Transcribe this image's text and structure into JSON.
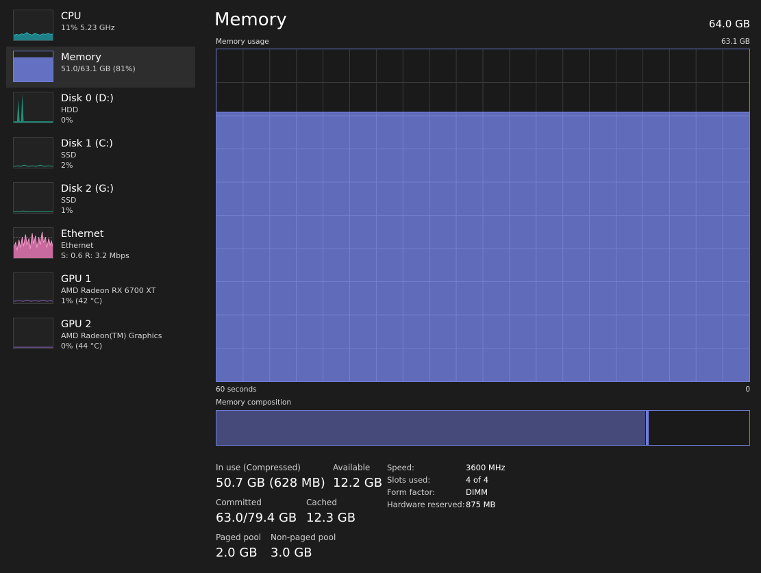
{
  "sidebar": {
    "items": [
      {
        "title": "CPU",
        "lines": [
          "11%  5.23 GHz"
        ]
      },
      {
        "title": "Memory",
        "lines": [
          "51.0/63.1 GB (81%)"
        ]
      },
      {
        "title": "Disk 0 (D:)",
        "lines": [
          "HDD",
          "0%"
        ]
      },
      {
        "title": "Disk 1 (C:)",
        "lines": [
          "SSD",
          "2%"
        ]
      },
      {
        "title": "Disk 2 (G:)",
        "lines": [
          "SSD",
          "1%"
        ]
      },
      {
        "title": "Ethernet",
        "lines": [
          "Ethernet",
          "S: 0.6  R: 3.2 Mbps"
        ]
      },
      {
        "title": "GPU 1",
        "lines": [
          "AMD Radeon RX 6700 XT",
          "1%  (42 °C)"
        ]
      },
      {
        "title": "GPU 2",
        "lines": [
          "AMD Radeon(TM) Graphics",
          "0%  (44 °C)"
        ]
      }
    ]
  },
  "main": {
    "title": "Memory",
    "total": "64.0 GB",
    "usage_label": "Memory usage",
    "usage_max": "63.1 GB",
    "time_left": "60 seconds",
    "time_right": "0",
    "usage_fraction": 0.81,
    "composition_label": "Memory composition",
    "composition": {
      "in_use_fraction": 0.805,
      "modified_fraction": 0.004,
      "standby_fraction": 0.191
    }
  },
  "stats": {
    "in_use": {
      "label": "In use (Compressed)",
      "value": "50.7 GB (628 MB)"
    },
    "available": {
      "label": "Available",
      "value": "12.2 GB"
    },
    "committed": {
      "label": "Committed",
      "value": "63.0/79.4 GB"
    },
    "cached": {
      "label": "Cached",
      "value": "12.3 GB"
    },
    "paged_pool": {
      "label": "Paged pool",
      "value": "2.0 GB"
    },
    "nonpaged_pool": {
      "label": "Non-paged pool",
      "value": "3.0 GB"
    }
  },
  "specs": [
    {
      "label": "Speed:",
      "value": "3600 MHz"
    },
    {
      "label": "Slots used:",
      "value": "4 of 4"
    },
    {
      "label": "Form factor:",
      "value": "DIMM"
    },
    {
      "label": "Hardware reserved:",
      "value": "875 MB"
    }
  ],
  "colors": {
    "memory_accent": "#6f7dd8",
    "memory_fill": "#6470c2",
    "cpu_accent": "#2fb3b8",
    "disk_accent": "#2aa58f",
    "ethernet_accent": "#e77fb5",
    "gpu_accent": "#8a62c2"
  }
}
